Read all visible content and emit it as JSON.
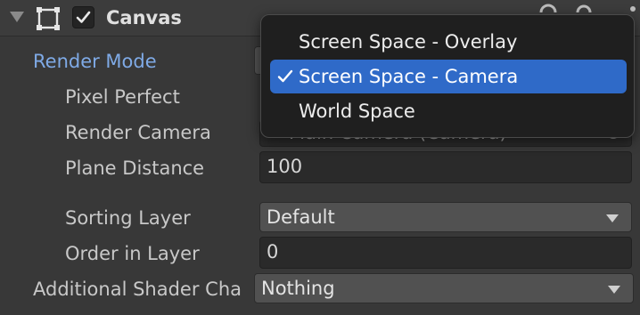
{
  "component": {
    "title": "Canvas",
    "enabled": true,
    "icons": [
      "foldout-arrow-icon",
      "canvas-component-icon",
      "checkbox-icon",
      "help-icon",
      "settings-icon",
      "more-icon"
    ]
  },
  "properties": {
    "render_mode": {
      "label": "Render Mode",
      "value": "Screen Space - Camera"
    },
    "pixel_perfect": {
      "label": "Pixel Perfect"
    },
    "render_camera": {
      "label": "Render Camera",
      "value": "Main Camera (Camera)"
    },
    "plane_distance": {
      "label": "Plane Distance",
      "value": "100"
    },
    "sorting_layer": {
      "label": "Sorting Layer",
      "value": "Default"
    },
    "order_in_layer": {
      "label": "Order in Layer",
      "value": "0"
    },
    "additional_shader_channels": {
      "label": "Additional Shader Cha",
      "value": "Nothing"
    }
  },
  "dropdown": {
    "options": [
      {
        "label": "Screen Space - Overlay",
        "selected": false
      },
      {
        "label": "Screen Space - Camera",
        "selected": true
      },
      {
        "label": "World Space",
        "selected": false
      }
    ]
  },
  "colors": {
    "active_label": "#7faae6",
    "selection": "#2f6ac8",
    "background": "#383838"
  }
}
